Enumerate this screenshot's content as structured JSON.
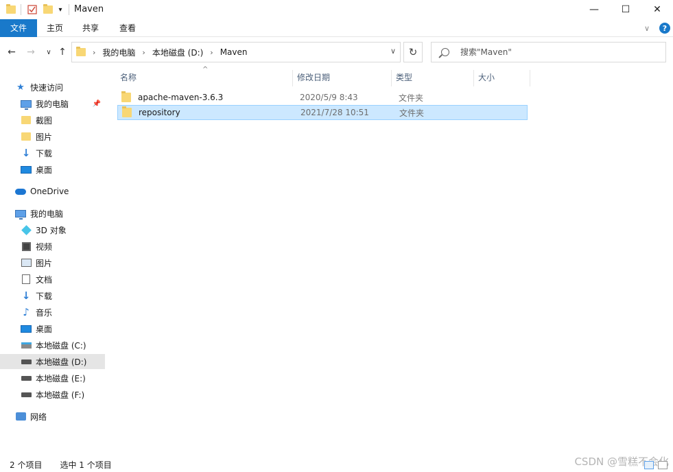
{
  "window": {
    "title": "Maven",
    "minimize": "—",
    "maximize": "☐",
    "close": "✕"
  },
  "ribbon": {
    "tabs": [
      "文件",
      "主页",
      "共享",
      "查看"
    ],
    "collapse": "∨",
    "help": "?"
  },
  "nav": {
    "back": "←",
    "forward": "→",
    "recent": "∨",
    "up": "↑",
    "breadcrumb": [
      "我的电脑",
      "本地磁盘 (D:)",
      "Maven"
    ],
    "dropdown": "∨",
    "refresh": "↻"
  },
  "search": {
    "placeholder": "搜索\"Maven\""
  },
  "sidebar": {
    "items": [
      {
        "label": "快速访问",
        "icon": "star-icon"
      },
      {
        "label": "我的电脑",
        "icon": "computer-icon",
        "pinned": true
      },
      {
        "label": "截图",
        "icon": "folder-icon"
      },
      {
        "label": "图片",
        "icon": "folder-icon"
      },
      {
        "label": "下载",
        "icon": "download-icon"
      },
      {
        "label": "桌面",
        "icon": "desktop-icon"
      },
      {
        "label": "OneDrive",
        "icon": "cloud-icon"
      },
      {
        "label": "我的电脑",
        "icon": "computer-icon"
      },
      {
        "label": "3D 对象",
        "icon": "3d-objects-icon"
      },
      {
        "label": "视频",
        "icon": "video-icon"
      },
      {
        "label": "图片",
        "icon": "pictures-icon"
      },
      {
        "label": "文档",
        "icon": "documents-icon"
      },
      {
        "label": "下载",
        "icon": "download-icon"
      },
      {
        "label": "音乐",
        "icon": "music-icon"
      },
      {
        "label": "桌面",
        "icon": "desktop-icon"
      },
      {
        "label": "本地磁盘 (C:)",
        "icon": "system-drive-icon"
      },
      {
        "label": "本地磁盘 (D:)",
        "icon": "drive-icon",
        "selected": true
      },
      {
        "label": "本地磁盘 (E:)",
        "icon": "drive-icon"
      },
      {
        "label": "本地磁盘 (F:)",
        "icon": "drive-icon"
      },
      {
        "label": "网络",
        "icon": "network-icon"
      }
    ]
  },
  "list": {
    "columns": {
      "name": "名称",
      "date": "修改日期",
      "type": "类型",
      "size": "大小"
    },
    "sort_caret": "^",
    "rows": [
      {
        "name": "apache-maven-3.6.3",
        "date": "2020/5/9 8:43",
        "type": "文件夹",
        "size": ""
      },
      {
        "name": "repository",
        "date": "2021/7/28 10:51",
        "type": "文件夹",
        "size": "",
        "selected": true
      }
    ]
  },
  "status": {
    "count": "2 个项目",
    "selection": "选中 1 个项目"
  },
  "watermark": "CSDN @雪糕不会化",
  "colors": {
    "accent": "#1979ca",
    "selection": "#cce8ff",
    "folder": "#f8d775"
  }
}
